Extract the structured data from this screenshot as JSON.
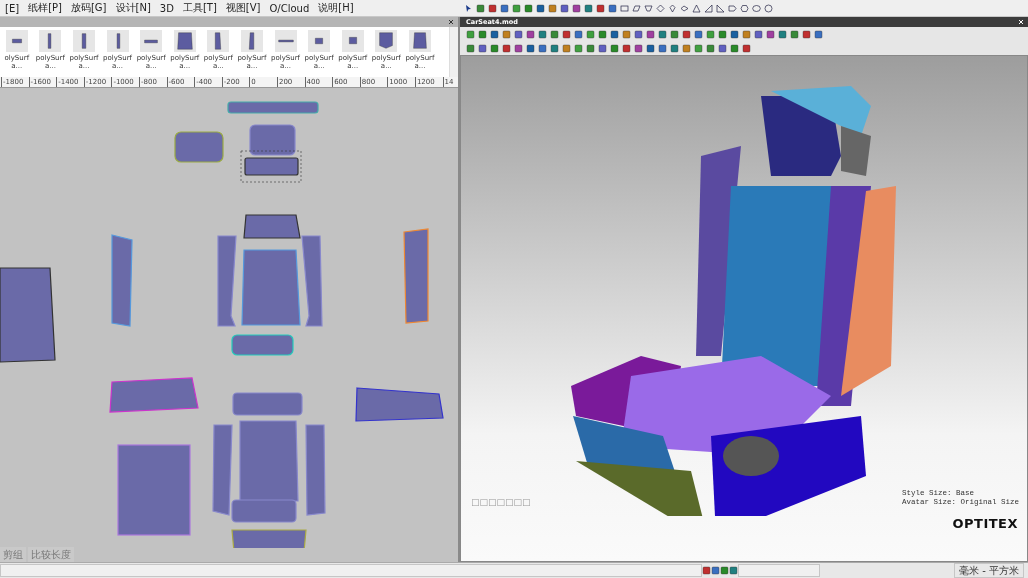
{
  "menu": [
    "[E]",
    "纸样[P]",
    "放码[G]",
    "设计[N]",
    "3D",
    "工具[T]",
    "视图[V]",
    "O/Cloud",
    "说明[H]"
  ],
  "thumbnails": [
    {
      "label": "olySurfa..."
    },
    {
      "label": "polySurfa..."
    },
    {
      "label": "polySurfa..."
    },
    {
      "label": "polySurfa..."
    },
    {
      "label": "polySurfa..."
    },
    {
      "label": "polySurfa..."
    },
    {
      "label": "polySurfa..."
    },
    {
      "label": "polySurfa..."
    },
    {
      "label": "polySurfa..."
    },
    {
      "label": "polySurfa..."
    },
    {
      "label": "polySurfa..."
    },
    {
      "label": "polySurfa..."
    },
    {
      "label": "polySurfa..."
    }
  ],
  "ruler": [
    "-1800",
    "-1600",
    "-1400",
    "-1200",
    "-1000",
    "-800",
    "-600",
    "-400",
    "-200",
    "0",
    "200",
    "400",
    "600",
    "800",
    "1000",
    "1200",
    "14"
  ],
  "tabs": [
    "剪组",
    "比较长度"
  ],
  "viewport": {
    "title": "CarSeat4.mod",
    "missing_glyphs": "□□□□□□□",
    "info": [
      "Style Size: Base",
      "Avatar Size: Original Size"
    ],
    "logo": "OPTITEX"
  },
  "status_bar": {
    "units": "毫米 - 平方米"
  }
}
